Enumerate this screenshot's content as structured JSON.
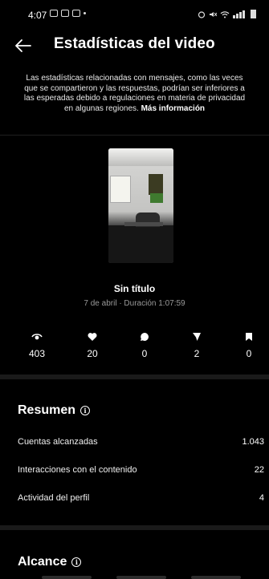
{
  "status_bar": {
    "time": "4:07",
    "notification_icons": [
      "image-icon",
      "messenger-icon",
      "instagram-icon"
    ],
    "system_icons": [
      "alarm-icon",
      "mute-icon",
      "wifi-icon",
      "signal-icon",
      "battery-icon"
    ]
  },
  "header": {
    "title": "Estadísticas del video",
    "back_icon": "arrow-left-icon"
  },
  "notice": {
    "text": "Las estadísticas relacionadas con mensajes, como las veces que se compartieron y las respuestas, podrían ser inferiores a las esperadas debido a regulaciones en materia de privacidad en algunas regiones. ",
    "link": "Más información"
  },
  "video": {
    "title": "Sin título",
    "meta": "7 de abril · Duración 1:07:59"
  },
  "stats": [
    {
      "icon": "eye-icon",
      "value": "403"
    },
    {
      "icon": "heart-icon",
      "value": "20"
    },
    {
      "icon": "comment-icon",
      "value": "0"
    },
    {
      "icon": "send-icon",
      "value": "2"
    },
    {
      "icon": "bookmark-icon",
      "value": "0"
    }
  ],
  "summary": {
    "title": "Resumen",
    "rows": [
      {
        "label": "Cuentas alcanzadas",
        "value": "1.043"
      },
      {
        "label": "Interacciones con el contenido",
        "value": "22"
      },
      {
        "label": "Actividad del perfil",
        "value": "4"
      }
    ]
  },
  "reach": {
    "title": "Alcance"
  },
  "colors": {
    "background": "#000000",
    "divider": "#1a1a1a",
    "muted_text": "#9a9a9a"
  }
}
